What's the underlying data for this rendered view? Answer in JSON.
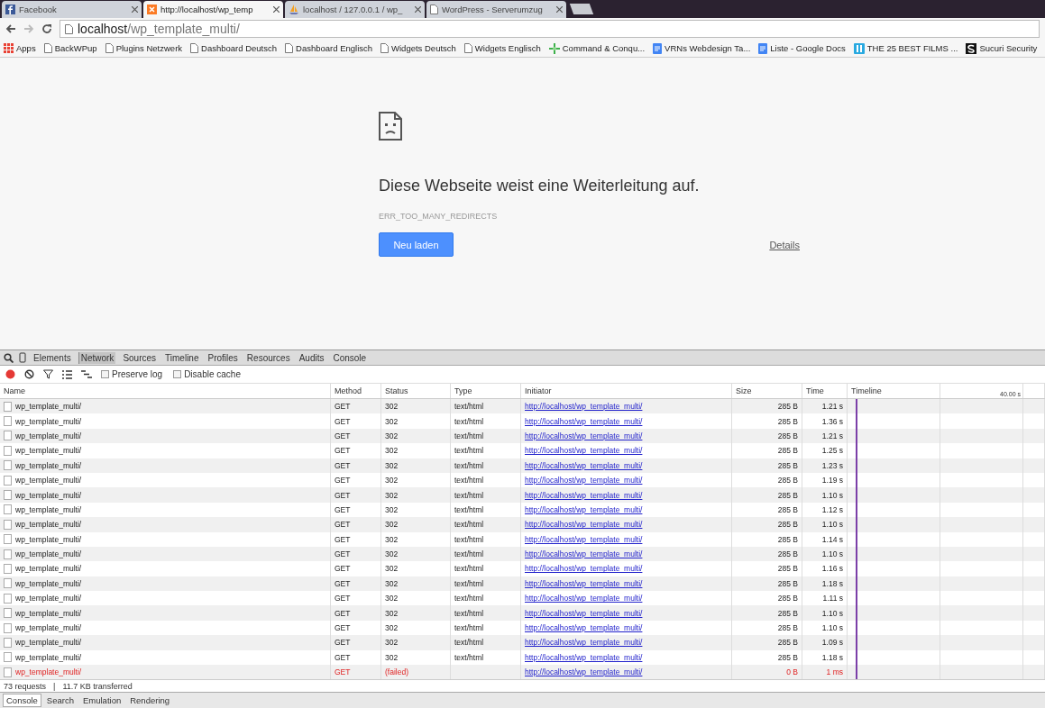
{
  "browser_tabs": [
    {
      "title": "Facebook",
      "kind": "facebook",
      "selected": false
    },
    {
      "title": "http://localhost/wp_temp",
      "kind": "xampp",
      "selected": true
    },
    {
      "title": "localhost / 127.0.0.1 / wp_",
      "kind": "pma",
      "selected": false
    },
    {
      "title": "WordPress - Serverumzug",
      "kind": "page",
      "selected": false
    }
  ],
  "address": {
    "host": "localhost",
    "path": "/wp_template_multi/"
  },
  "bookmarks": [
    {
      "label": "Apps",
      "kind": "apps"
    },
    {
      "label": "BackWPup",
      "kind": "page"
    },
    {
      "label": "Plugins Netzwerk",
      "kind": "page"
    },
    {
      "label": "Dashboard Deutsch",
      "kind": "page"
    },
    {
      "label": "Dashboard Englisch",
      "kind": "page"
    },
    {
      "label": "Widgets Deutsch",
      "kind": "page"
    },
    {
      "label": "Widgets Englisch",
      "kind": "page"
    },
    {
      "label": "Command & Conqu...",
      "kind": "cross"
    },
    {
      "label": "VRNs Webdesign Ta...",
      "kind": "doc"
    },
    {
      "label": "Liste - Google Docs",
      "kind": "doc"
    },
    {
      "label": "THE 25 BEST FILMS ...",
      "kind": "board"
    },
    {
      "label": "Sucuri Security",
      "kind": "sucuri"
    }
  ],
  "error_page": {
    "heading": "Diese Webseite weist eine Weiterleitung auf.",
    "code": "ERR_TOO_MANY_REDIRECTS",
    "reload_button": "Neu laden",
    "details_link": "Details"
  },
  "devtools": {
    "panels": [
      {
        "label": "Elements",
        "selected": false
      },
      {
        "label": "Network",
        "selected": true
      },
      {
        "label": "Sources",
        "selected": false
      },
      {
        "label": "Timeline",
        "selected": false
      },
      {
        "label": "Profiles",
        "selected": false
      },
      {
        "label": "Resources",
        "selected": false
      },
      {
        "label": "Audits",
        "selected": false
      },
      {
        "label": "Console",
        "selected": false
      }
    ],
    "options": [
      {
        "label": "Preserve log",
        "checked": false
      },
      {
        "label": "Disable cache",
        "checked": false
      }
    ],
    "columns": [
      "Name",
      "Method",
      "Status",
      "Type",
      "Initiator",
      "Size",
      "Time",
      "Timeline"
    ],
    "timeline_scale": "40.00 s",
    "rows": [
      {
        "name": "wp_template_multi/",
        "method": "GET",
        "status": "302",
        "type": "text/html",
        "initiator": "http://localhost/wp_template_multi/",
        "size": "285 B",
        "time": "1.21 s",
        "failed": false
      },
      {
        "name": "wp_template_multi/",
        "method": "GET",
        "status": "302",
        "type": "text/html",
        "initiator": "http://localhost/wp_template_multi/",
        "size": "285 B",
        "time": "1.36 s",
        "failed": false
      },
      {
        "name": "wp_template_multi/",
        "method": "GET",
        "status": "302",
        "type": "text/html",
        "initiator": "http://localhost/wp_template_multi/",
        "size": "285 B",
        "time": "1.21 s",
        "failed": false
      },
      {
        "name": "wp_template_multi/",
        "method": "GET",
        "status": "302",
        "type": "text/html",
        "initiator": "http://localhost/wp_template_multi/",
        "size": "285 B",
        "time": "1.25 s",
        "failed": false
      },
      {
        "name": "wp_template_multi/",
        "method": "GET",
        "status": "302",
        "type": "text/html",
        "initiator": "http://localhost/wp_template_multi/",
        "size": "285 B",
        "time": "1.23 s",
        "failed": false
      },
      {
        "name": "wp_template_multi/",
        "method": "GET",
        "status": "302",
        "type": "text/html",
        "initiator": "http://localhost/wp_template_multi/",
        "size": "285 B",
        "time": "1.19 s",
        "failed": false
      },
      {
        "name": "wp_template_multi/",
        "method": "GET",
        "status": "302",
        "type": "text/html",
        "initiator": "http://localhost/wp_template_multi/",
        "size": "285 B",
        "time": "1.10 s",
        "failed": false
      },
      {
        "name": "wp_template_multi/",
        "method": "GET",
        "status": "302",
        "type": "text/html",
        "initiator": "http://localhost/wp_template_multi/",
        "size": "285 B",
        "time": "1.12 s",
        "failed": false
      },
      {
        "name": "wp_template_multi/",
        "method": "GET",
        "status": "302",
        "type": "text/html",
        "initiator": "http://localhost/wp_template_multi/",
        "size": "285 B",
        "time": "1.10 s",
        "failed": false
      },
      {
        "name": "wp_template_multi/",
        "method": "GET",
        "status": "302",
        "type": "text/html",
        "initiator": "http://localhost/wp_template_multi/",
        "size": "285 B",
        "time": "1.14 s",
        "failed": false
      },
      {
        "name": "wp_template_multi/",
        "method": "GET",
        "status": "302",
        "type": "text/html",
        "initiator": "http://localhost/wp_template_multi/",
        "size": "285 B",
        "time": "1.10 s",
        "failed": false
      },
      {
        "name": "wp_template_multi/",
        "method": "GET",
        "status": "302",
        "type": "text/html",
        "initiator": "http://localhost/wp_template_multi/",
        "size": "285 B",
        "time": "1.16 s",
        "failed": false
      },
      {
        "name": "wp_template_multi/",
        "method": "GET",
        "status": "302",
        "type": "text/html",
        "initiator": "http://localhost/wp_template_multi/",
        "size": "285 B",
        "time": "1.18 s",
        "failed": false
      },
      {
        "name": "wp_template_multi/",
        "method": "GET",
        "status": "302",
        "type": "text/html",
        "initiator": "http://localhost/wp_template_multi/",
        "size": "285 B",
        "time": "1.11 s",
        "failed": false
      },
      {
        "name": "wp_template_multi/",
        "method": "GET",
        "status": "302",
        "type": "text/html",
        "initiator": "http://localhost/wp_template_multi/",
        "size": "285 B",
        "time": "1.10 s",
        "failed": false
      },
      {
        "name": "wp_template_multi/",
        "method": "GET",
        "status": "302",
        "type": "text/html",
        "initiator": "http://localhost/wp_template_multi/",
        "size": "285 B",
        "time": "1.10 s",
        "failed": false
      },
      {
        "name": "wp_template_multi/",
        "method": "GET",
        "status": "302",
        "type": "text/html",
        "initiator": "http://localhost/wp_template_multi/",
        "size": "285 B",
        "time": "1.09 s",
        "failed": false
      },
      {
        "name": "wp_template_multi/",
        "method": "GET",
        "status": "302",
        "type": "text/html",
        "initiator": "http://localhost/wp_template_multi/",
        "size": "285 B",
        "time": "1.18 s",
        "failed": false
      },
      {
        "name": "wp_template_multi/",
        "method": "GET",
        "status": "(failed)",
        "initiator": "http://localhost/wp_template_multi/",
        "size": "0 B",
        "time": "1 ms",
        "failed": true
      }
    ],
    "summary": {
      "requests": "73 requests",
      "separator": "|",
      "transferred": "11.7 KB transferred"
    },
    "drawer_tabs": [
      {
        "label": "Console",
        "selected": true
      },
      {
        "label": "Search",
        "selected": false
      },
      {
        "label": "Emulation",
        "selected": false
      },
      {
        "label": "Rendering",
        "selected": false
      }
    ]
  }
}
